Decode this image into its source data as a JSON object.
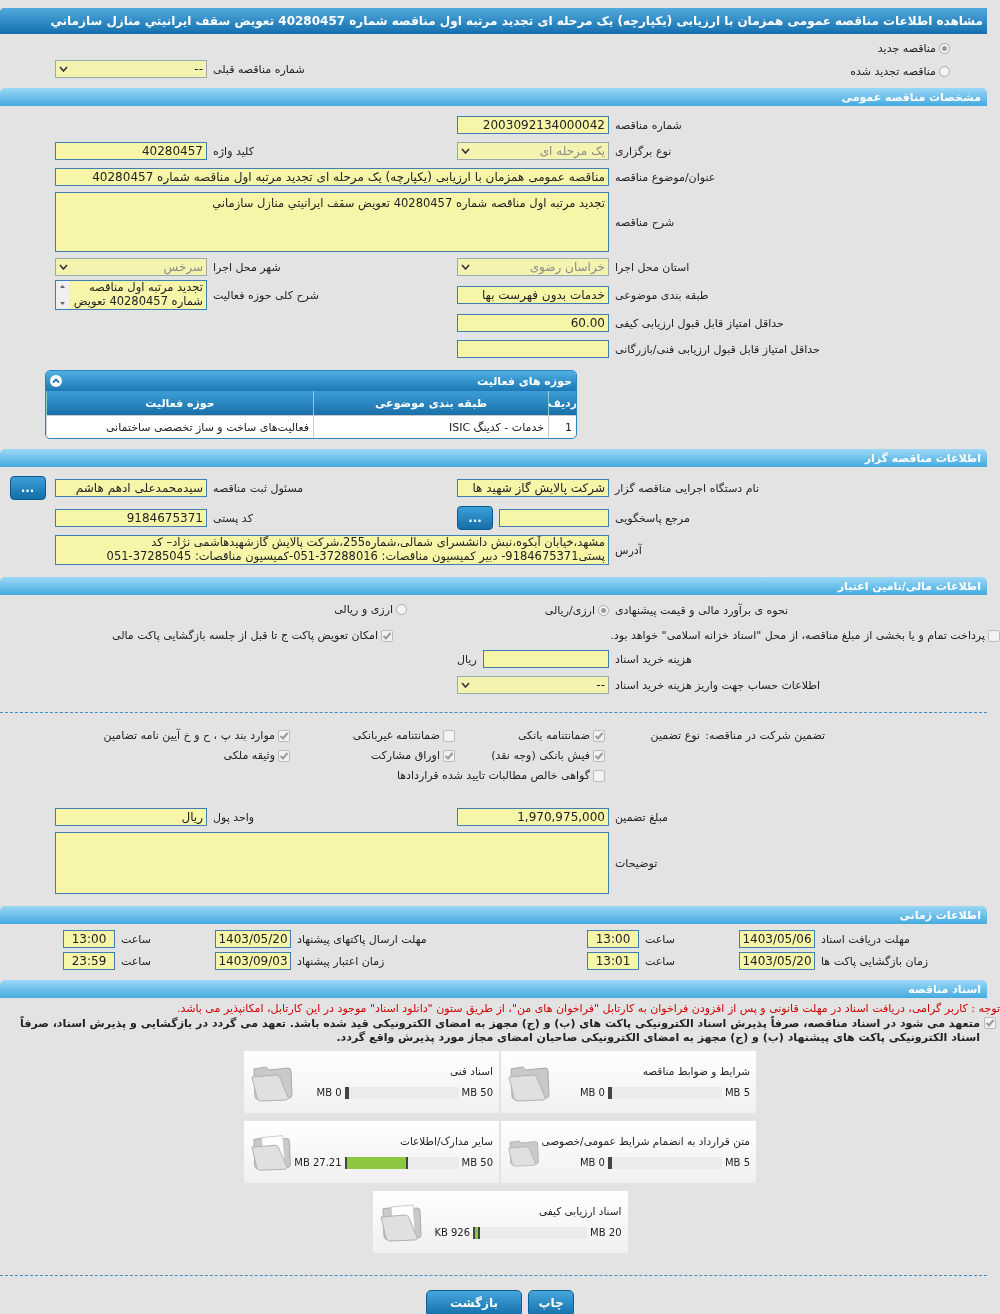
{
  "title": "مشاهده اطلاعات مناقصه عمومی همزمان با ارزیابی (یکپارچه) یک مرحله ای تجدید مرتبه اول مناقصه شماره 40280457 تعویض سقف ایرانیتي منازل سازماني",
  "tender_kind": [
    {
      "label": "مناقصه جدید",
      "selected": true
    },
    {
      "label": "مناقصه تجدید شده",
      "selected": false
    }
  ],
  "previous_tender": {
    "label": "شماره مناقصه قبلی",
    "value": "--",
    "kind": "select"
  },
  "general": {
    "title": "مشخصات مناقصه عمومی",
    "rows": [
      [
        {
          "label": "شماره مناقصه",
          "value": "2003092134000042",
          "kind": "text"
        }
      ],
      [
        {
          "label": "نوع برگزاری",
          "value": "یک مرحله ای",
          "kind": "select",
          "disabled": true
        },
        {
          "label": "کلید واژه",
          "value": "40280457",
          "kind": "text"
        }
      ],
      [
        {
          "label": "عنوان/موضوع مناقصه",
          "value": "مناقصه عمومی همزمان با ارزیابی (یکپارچه) یک مرحله ای تجدید مرتبه اول مناقصه شماره 40280457",
          "kind": "wide"
        }
      ],
      [
        {
          "label": "شرح مناقصه",
          "value": "تجدید مرتبه اول مناقصه شماره 40280457 تعویض سقف ایرانیتي منازل سازماني",
          "kind": "area"
        }
      ],
      [
        {
          "label": "استان محل اجرا",
          "value": "خراسان رضوی",
          "kind": "select",
          "disabled": true
        },
        {
          "label": "شهر محل اجرا",
          "value": "سرخس",
          "kind": "select",
          "disabled": true
        }
      ],
      [
        {
          "label": "طبقه بندی موضوعی",
          "value": "خدمات بدون فهرست بها",
          "kind": "text"
        },
        {
          "label": "شرح کلی حوزه فعالیت",
          "value": "تجدید مرتبه اول مناقصه شماره 40280457 تعویض",
          "kind": "scroll"
        }
      ],
      [
        {
          "label": "حداقل امتیاز قابل قبول ارزیابی کیفی",
          "value": "60.00",
          "kind": "text"
        }
      ],
      [
        {
          "label": "حداقل امتیاز قابل قبول ارزیابی فنی/بازرگانی",
          "kind": "text"
        }
      ]
    ],
    "activity_table": {
      "title": "حوزه های فعالیت",
      "columns": [
        "ردیف",
        "طبقه بندی موضوعی",
        "حوزه فعالیت"
      ],
      "rows": [
        [
          "1",
          "خدمات - کدینگ ISIC",
          "فعالیت‌های ساخت و ساز تخصصی ساختمانی"
        ]
      ]
    }
  },
  "organizer": {
    "title": "اطلاعات مناقصه گزار",
    "rows": [
      [
        {
          "label": "نام دستگاه اجرایی مناقصه گزار",
          "value": "شرکت پالایش گاز شهید ها",
          "kind": "text"
        },
        {
          "label": "مسئول ثبت مناقصه",
          "value": "سیدمحمدعلی ادهم هاشم",
          "kind": "text",
          "button": "..."
        }
      ],
      [
        {
          "label": "مرجع پاسخگویی",
          "kind": "text",
          "button": "..."
        },
        {
          "label": "کد پستی",
          "value": "9184675371",
          "kind": "text"
        }
      ],
      [
        {
          "label": "آدرس",
          "value": "مشهد،خیابان آبکوه،نبش دانشسرای شمالی،شماره255،شرکت پالایش گازشهیدهاشمی نژاد– کد پستی9184675371- دبیر کمیسیون مناقصات: 37288016-051-کمیسیون مناقصات: 37285045-051",
          "kind": "address"
        }
      ]
    ]
  },
  "finance": {
    "title": "اطلاعات مالی/تامین اعتبار",
    "estimate": {
      "label": "نحوه ی برآورد مالی و قیمت پیشنهادی",
      "options": [
        {
          "label": "ارزی/ریالی",
          "selected": true
        },
        {
          "label": "ارزی و ریالی",
          "selected": false
        }
      ]
    },
    "checks": [
      {
        "label": "پرداخت تمام و یا بخشی از مبلغ مناقصه، از محل \"اسناد خزانه اسلامی\" خواهد بود.",
        "checked": false
      },
      {
        "label": "امکان تعویض پاکت ج تا قبل از جلسه بازگشایی پاکت مالی",
        "checked": true
      }
    ],
    "rows": [
      [
        {
          "label": "هزینه خرید اسناد",
          "kind": "text",
          "unit": "ریال"
        }
      ],
      [
        {
          "label": "اطلاعات حساب جهت واریز هزینه خرید اسناد",
          "value": "--",
          "kind": "select"
        }
      ]
    ]
  },
  "guarantee": {
    "label": "تضمین شرکت در مناقصه:",
    "type_label": "نوع تضمین",
    "options": [
      {
        "label": "ضمانتنامه بانکی",
        "checked": true
      },
      {
        "label": "ضمانتنامه غیربانکی",
        "checked": false
      },
      {
        "label": "موارد بند پ ، ح و خ آیین نامه تضامین",
        "checked": true
      },
      {
        "label": "فیش بانکی (وجه نقد)",
        "checked": true
      },
      {
        "label": "اوراق مشارکت",
        "checked": true
      },
      {
        "label": "وثیقه ملکی",
        "checked": true
      },
      {
        "label": "گواهی خالص مطالبات تایید شده قراردادها",
        "checked": false
      }
    ],
    "rows": [
      [
        {
          "label": "مبلغ تضمین",
          "value": "1,970,975,000",
          "kind": "text"
        },
        {
          "label": "واحد پول",
          "value": "ریال",
          "kind": "text"
        }
      ],
      [
        {
          "label": "توضیحات",
          "kind": "big"
        }
      ]
    ]
  },
  "timing": {
    "title": "اطلاعات زمانی",
    "rows": [
      [
        {
          "label": "مهلت دریافت اسناد",
          "date": "1403/05/06",
          "time_label": "ساعت",
          "time": "13:00"
        },
        {
          "label": "مهلت ارسال پاکتهای پیشنهاد",
          "date": "1403/05/20",
          "time_label": "ساعت",
          "time": "13:00"
        }
      ],
      [
        {
          "label": "زمان بازگشایی پاکت ها",
          "date": "1403/05/20",
          "time_label": "ساعت",
          "time": "13:01"
        },
        {
          "label": "زمان اعتبار پیشنهاد",
          "date": "1403/09/03",
          "time_label": "ساعت",
          "time": "23:59"
        }
      ]
    ]
  },
  "documents": {
    "title": "اسناد مناقصه",
    "notice": "توجه : کاربر گرامی، دریافت اسناد در مهلت قانونی و پس از افزودن فراخوان به کارتابل \"فراخوان های من\"، از طریق ستون \"دانلود اسناد\" موجود در این کارتابل، امکانپذیر می باشد.",
    "pledge": {
      "label": "متعهد می شود در اسناد مناقصه، صرفاً پذیرش اسناد الکترونیکی پاکت های (ب) و (ج) مجهز به امضای الکترونیکی قید شده باشد. تعهد می گردد در بازگشایی و پذیرش اسناد، صرفاً اسناد الکترونیکی پاکت های پیشنهاد (ب) و (ج) مجهز به امضای الکترونیکی صاحبان امضای مجاز مورد پذیرش واقع گردد.",
      "checked": true
    },
    "files": [
      {
        "title": "شرایط و ضوابط مناقصه",
        "used": "0 MB",
        "max": "5 MB",
        "level": 0
      },
      {
        "title": "اسناد فنی",
        "used": "0 MB",
        "max": "50 MB",
        "level": 0
      },
      {
        "title": "متن قرارداد به انضمام شرایط عمومی/خصوصی",
        "used": "0 MB",
        "max": "5 MB",
        "level": 0
      },
      {
        "title": "سایر مدارک/اطلاعات",
        "used": "27.21 MB",
        "max": "50 MB",
        "level": 0.544
      },
      {
        "title": "اسناد ارزیابی کیفی",
        "used": "926 KB",
        "max": "20 MB",
        "level": 0.045
      }
    ]
  },
  "buttons": [
    "چاپ",
    "بازگشت"
  ]
}
